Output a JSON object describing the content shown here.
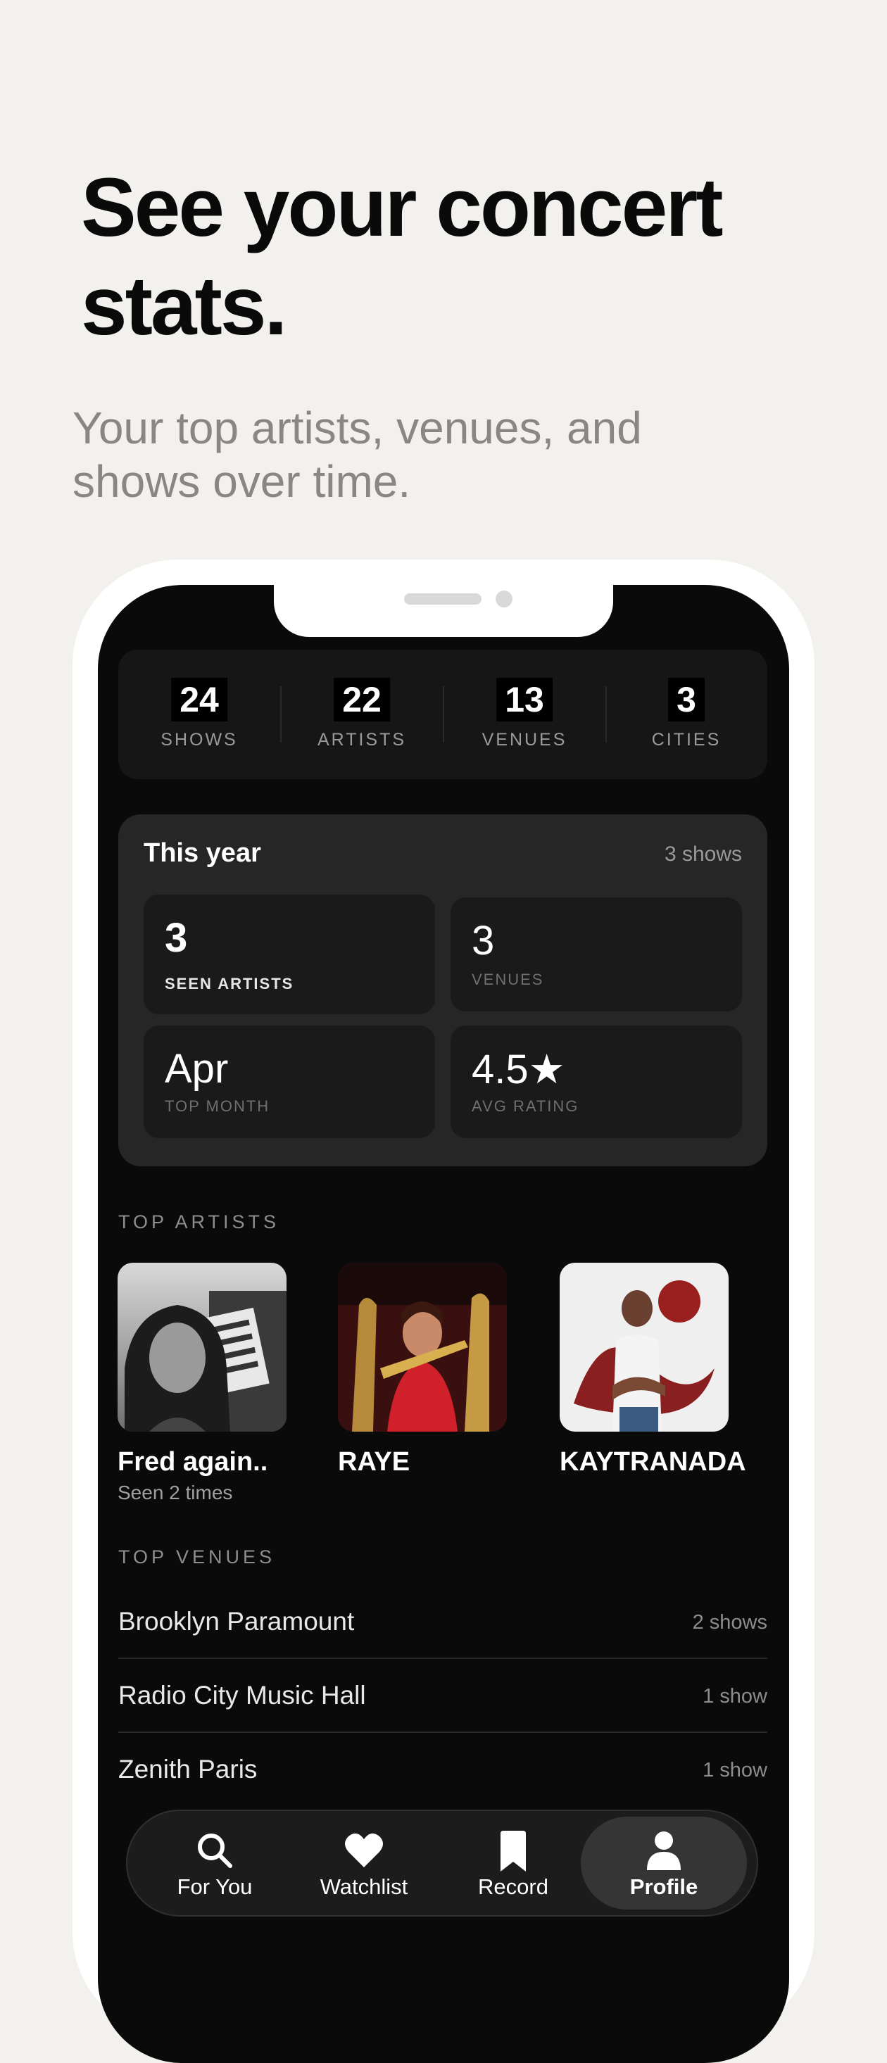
{
  "hero": {
    "title": "See your concert stats.",
    "subtitle": "Your top artists, venues, and shows over time."
  },
  "stats": [
    {
      "value": "24",
      "label": "SHOWS"
    },
    {
      "value": "22",
      "label": "ARTISTS"
    },
    {
      "value": "13",
      "label": "VENUES"
    },
    {
      "value": "3",
      "label": "CITIES"
    }
  ],
  "this_year": {
    "title": "This year",
    "shows": "3 shows",
    "tiles": [
      {
        "value": "3",
        "label": "SEEN ARTISTS"
      },
      {
        "value": "3",
        "label": "VENUES"
      },
      {
        "value": "Apr",
        "label": "TOP MONTH"
      },
      {
        "value": "4.5★",
        "label": "AVG RATING"
      }
    ]
  },
  "top_artists": {
    "title": "TOP ARTISTS",
    "items": [
      {
        "name": "Fred again..",
        "sub": "Seen 2 times"
      },
      {
        "name": "RAYE",
        "sub": ""
      },
      {
        "name": "KAYTRANADA",
        "sub": ""
      }
    ]
  },
  "top_venues": {
    "title": "TOP VENUES",
    "items": [
      {
        "name": "Brooklyn Paramount",
        "count": "2 shows"
      },
      {
        "name": "Radio City Music Hall",
        "count": "1 show"
      },
      {
        "name": "Zenith Paris",
        "count": "1 show"
      }
    ]
  },
  "tabs": [
    {
      "label": "For You",
      "icon": "search-icon"
    },
    {
      "label": "Watchlist",
      "icon": "heart-icon"
    },
    {
      "label": "Record",
      "icon": "bookmark-icon"
    },
    {
      "label": "Profile",
      "icon": "person-icon",
      "active": true
    }
  ],
  "colors": {
    "background": "#f3f1ed",
    "screen": "#0a0a0a",
    "card": "#262626"
  }
}
